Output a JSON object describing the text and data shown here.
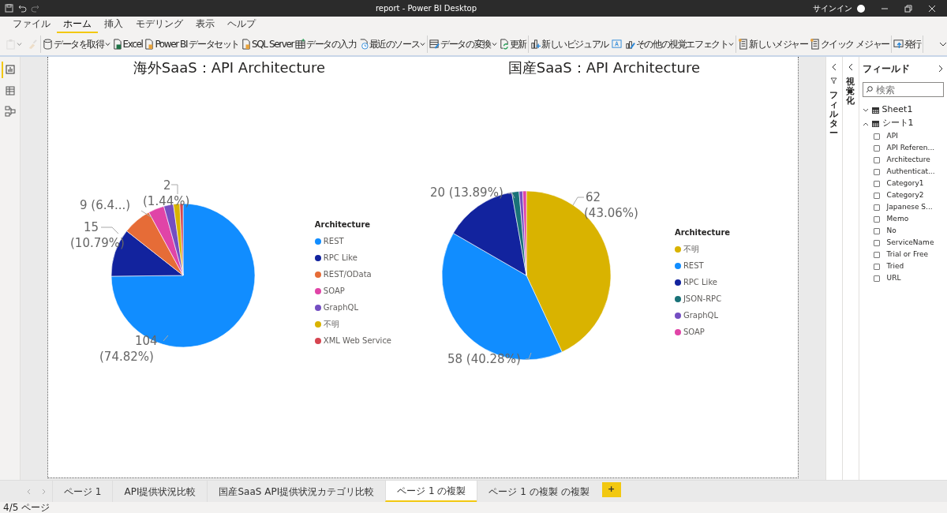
{
  "window": {
    "title": "report - Power BI Desktop",
    "sign_in": "サインイン"
  },
  "menu_tabs": [
    {
      "label": "ファイル",
      "selected": false
    },
    {
      "label": "ホーム",
      "selected": true
    },
    {
      "label": "挿入",
      "selected": false
    },
    {
      "label": "モデリング",
      "selected": false
    },
    {
      "label": "表示",
      "selected": false
    },
    {
      "label": "ヘルプ",
      "selected": false
    }
  ],
  "ribbon": [
    {
      "kind": "icon",
      "dropdown": true,
      "disabled": true
    },
    {
      "kind": "icon",
      "dropdown": false,
      "disabled": true
    },
    {
      "kind": "sep"
    },
    {
      "kind": "button",
      "label": "データを取得",
      "dropdown": true
    },
    {
      "kind": "button",
      "label": "Excel",
      "dropdown": false
    },
    {
      "kind": "button",
      "label": "Power BI データセット",
      "dropdown": false
    },
    {
      "kind": "button",
      "label": "SQL Server",
      "dropdown": false
    },
    {
      "kind": "button",
      "label": "データの入力",
      "dropdown": false
    },
    {
      "kind": "button",
      "label": "最近のソース",
      "dropdown": true
    },
    {
      "kind": "sep"
    },
    {
      "kind": "button",
      "label": "データの変換",
      "dropdown": true
    },
    {
      "kind": "button",
      "label": "更新",
      "dropdown": false
    },
    {
      "kind": "sep"
    },
    {
      "kind": "button",
      "label": "新しいビジュアル",
      "dropdown": false
    },
    {
      "kind": "icon",
      "dropdown": false,
      "disabled": false
    },
    {
      "kind": "button",
      "label": "その他の視覚エフェクト",
      "dropdown": true
    },
    {
      "kind": "sep"
    },
    {
      "kind": "button",
      "label": "新しいメジャー",
      "dropdown": false
    },
    {
      "kind": "button",
      "label": "クイック メジャー",
      "dropdown": false
    },
    {
      "kind": "sep"
    },
    {
      "kind": "button",
      "label": "発行",
      "dropdown": false
    },
    {
      "kind": "sep"
    }
  ],
  "left_rail": [
    {
      "selected": true
    },
    {
      "selected": false
    },
    {
      "selected": false
    }
  ],
  "visuals": [
    {
      "data_labels": [
        {
          "lines": [
            "9 (6.4...)"
          ]
        },
        {
          "lines": [
            "2",
            "(1.44%)"
          ]
        },
        {
          "lines": [
            "15",
            "(10.79%)"
          ]
        },
        {
          "lines": [
            "104",
            "(74.82%)"
          ]
        }
      ],
      "chart_data": {
        "type": "pie",
        "title": "海外SaaS：API Architecture",
        "categories": [
          "REST",
          "RPC Like",
          "REST/OData",
          "SOAP",
          "GraphQL",
          "不明",
          "XML Web Service"
        ],
        "series": [
          {
            "name": "Architecture",
            "colors": [
              "#118dff",
              "#12239e",
              "#e66c37",
              "#e044a7",
              "#744ec2",
              "#d9b300",
              "#d64550"
            ],
            "values": [
              74.82,
              10.79,
              6.47,
              3.6,
              2.16,
              1.44,
              0.72
            ]
          }
        ]
      }
    },
    {
      "data_labels": [
        {
          "lines": [
            "20 (13.89%)"
          ]
        },
        {
          "lines": [
            "62",
            "(43.06%)"
          ]
        },
        {
          "lines": [
            "58 (40.28%)"
          ]
        }
      ],
      "chart_data": {
        "type": "pie",
        "title": "国産SaaS：API Architecture",
        "categories": [
          "不明",
          "REST",
          "RPC Like",
          "JSON-RPC",
          "GraphQL",
          "SOAP"
        ],
        "series": [
          {
            "name": "Architecture",
            "colors": [
              "#d9b300",
              "#118dff",
              "#12239e",
              "#197278",
              "#744ec2",
              "#e044a7"
            ],
            "values": [
              43.06,
              40.28,
              13.89,
              1.39,
              0.69,
              0.69
            ]
          }
        ]
      }
    }
  ],
  "filters_pane": {
    "label": "フィルター"
  },
  "visualizations_pane": {
    "label": "視覚化"
  },
  "fields": {
    "title": "フィールド",
    "search_placeholder": "検索",
    "tables": [
      {
        "name": "Sheet1",
        "expanded": false
      },
      {
        "name": "シート1",
        "expanded": true,
        "fields": [
          {
            "name": "API",
            "checked": false
          },
          {
            "name": "API Referen...",
            "checked": false
          },
          {
            "name": "Architecture",
            "checked": false
          },
          {
            "name": "Authenticat...",
            "checked": false
          },
          {
            "name": "Category1",
            "checked": false
          },
          {
            "name": "Category2",
            "checked": false
          },
          {
            "name": "Japanese S...",
            "checked": false
          },
          {
            "name": "Memo",
            "checked": false
          },
          {
            "name": "No",
            "checked": false
          },
          {
            "name": "ServiceName",
            "checked": false
          },
          {
            "name": "Trial or Free",
            "checked": false
          },
          {
            "name": "Tried",
            "checked": false
          },
          {
            "name": "URL",
            "checked": false
          }
        ]
      }
    ]
  },
  "page_tabs": [
    {
      "label": "ページ 1",
      "selected": false
    },
    {
      "label": "API提供状況比較",
      "selected": false
    },
    {
      "label": "国産SaaS API提供状況カテゴリ比較",
      "selected": false
    },
    {
      "label": "ページ 1 の複製",
      "selected": true
    },
    {
      "label": "ページ 1 の複製 の複製",
      "selected": false
    }
  ],
  "add_page": "+",
  "status_bar": "4/5 ページ"
}
